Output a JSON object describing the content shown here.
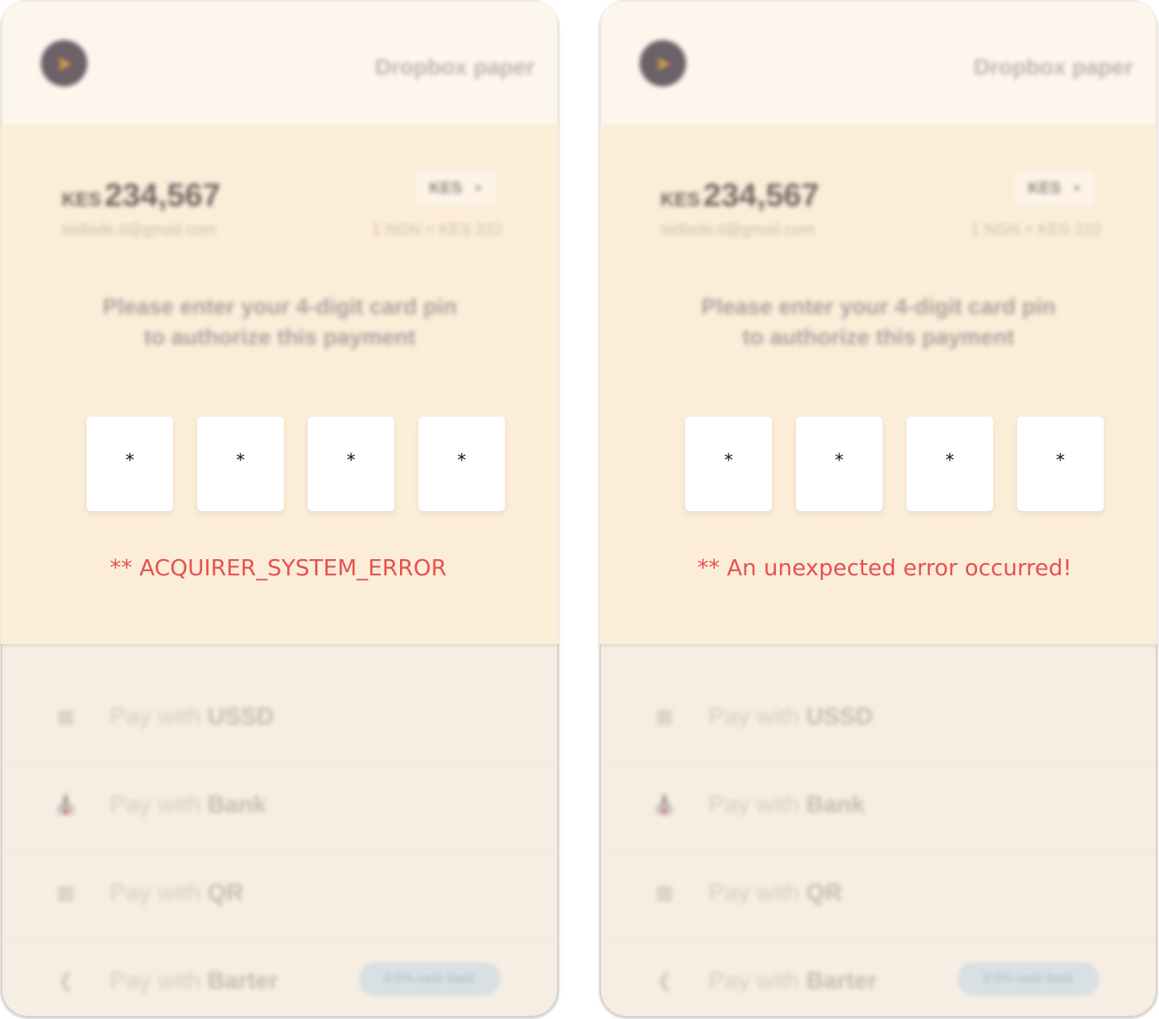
{
  "panels": [
    {
      "merchant_name": "Dropbox paper",
      "amount_currency": "KES",
      "amount_value": "234,567",
      "email": "tedlade.tl@gmail.com",
      "currency_select": "KES",
      "exchange_rate": "1 NGN = KES 222",
      "prompt_line1": "Please enter your 4-digit card pin",
      "prompt_line2": "to authorize this payment",
      "pin_digits": [
        "*",
        "*",
        "*",
        "*"
      ],
      "error_message": "** ACQUIRER_SYSTEM_ERROR",
      "methods": [
        {
          "prefix": "Pay with",
          "name": "USSD",
          "icon": "ussd-icon"
        },
        {
          "prefix": "Pay with",
          "name": "Bank",
          "icon": "bank-icon"
        },
        {
          "prefix": "Pay with",
          "name": "QR",
          "icon": "qr-icon"
        },
        {
          "prefix": "Pay with",
          "name": "Barter",
          "icon": "barter-icon",
          "badge": "0.5% cash back"
        }
      ]
    },
    {
      "merchant_name": "Dropbox paper",
      "amount_currency": "KES",
      "amount_value": "234,567",
      "email": "tedlade.tl@gmail.com",
      "currency_select": "KES",
      "exchange_rate": "1 NGN = KES 222",
      "prompt_line1": "Please enter your 4-digit card pin",
      "prompt_line2": "to authorize this payment",
      "pin_digits": [
        "*",
        "*",
        "*",
        "*"
      ],
      "error_message": "** An unexpected error occurred!",
      "methods": [
        {
          "prefix": "Pay with",
          "name": "USSD",
          "icon": "ussd-icon"
        },
        {
          "prefix": "Pay with",
          "name": "Bank",
          "icon": "bank-icon"
        },
        {
          "prefix": "Pay with",
          "name": "QR",
          "icon": "qr-icon"
        },
        {
          "prefix": "Pay with",
          "name": "Barter",
          "icon": "barter-icon",
          "badge": "0.5% cash back"
        }
      ]
    }
  ],
  "colors": {
    "error": "#e5524f",
    "main_bg": "#fcedd9",
    "header_bg": "#fdf6ec"
  }
}
